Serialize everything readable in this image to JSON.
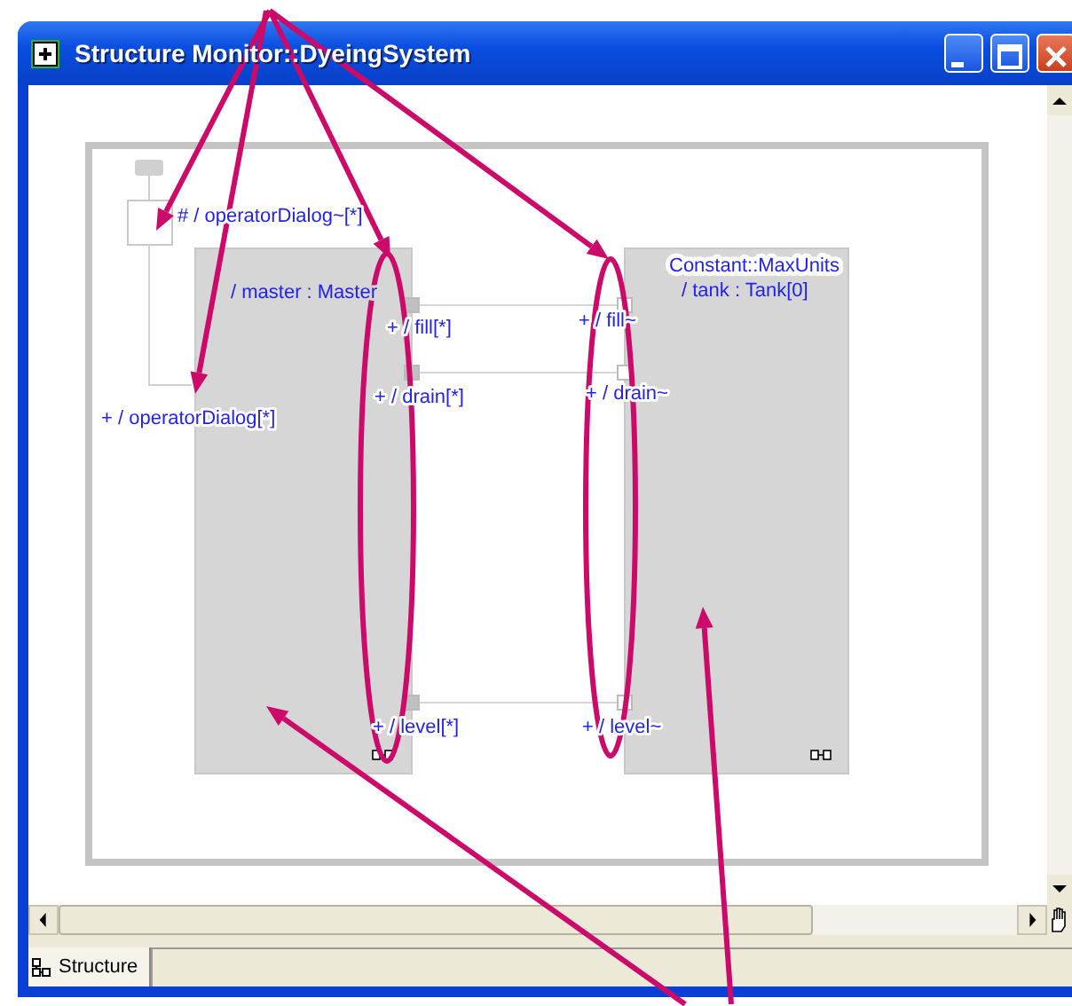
{
  "window": {
    "title": "Structure Monitor::DyeingSystem"
  },
  "diagram": {
    "boundary_port": {
      "label": "# / operatorDialog~[*]"
    },
    "external_port": {
      "label": "+ / operatorDialog[*]"
    },
    "parts": [
      {
        "name": "/ master : Master",
        "ports": [
          {
            "label": "+ / fill[*]",
            "filled": true
          },
          {
            "label": "+ / drain[*]",
            "filled": true
          },
          {
            "label": "+ / level[*]",
            "filled": true
          }
        ]
      },
      {
        "name": "/ tank : Tank[0]",
        "constant": "Constant::MaxUnits",
        "ports": [
          {
            "label": "+ / fill~",
            "filled": false
          },
          {
            "label": "+ / drain~",
            "filled": false
          },
          {
            "label": "+ / level~",
            "filled": false
          }
        ]
      }
    ]
  },
  "tabs": [
    {
      "label": "Structure",
      "selected": true
    }
  ]
}
